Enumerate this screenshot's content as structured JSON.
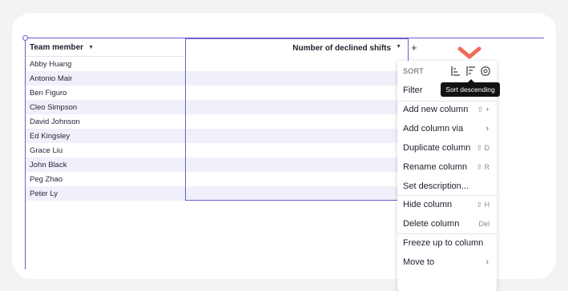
{
  "table": {
    "columns": [
      {
        "label": "Team member"
      },
      {
        "label": "Number of declined shifts"
      }
    ],
    "add_column_symbol": "+",
    "rows": [
      "Abby Huang",
      "Antonio Mair",
      "Ben Figuro",
      "Cleo Simpson",
      "David Johnson",
      "Ed Kingsley",
      "Grace Liu",
      "John Black",
      "Peg Zhao",
      "Peter Ly"
    ]
  },
  "menu": {
    "sort_label": "SORT",
    "items": [
      {
        "label": "Filter",
        "shortcut": "",
        "submenu": false
      },
      {
        "label": "Add new column",
        "shortcut": "⇧ +",
        "submenu": false
      },
      {
        "label": "Add column via",
        "shortcut": "",
        "submenu": true
      },
      {
        "label": "Duplicate column",
        "shortcut": "⇧ D",
        "submenu": false
      },
      {
        "label": "Rename column",
        "shortcut": "⇧ R",
        "submenu": false
      },
      {
        "label": "Set description...",
        "shortcut": "",
        "submenu": false
      },
      {
        "label": "Hide column",
        "shortcut": "⇧ H",
        "submenu": false
      },
      {
        "label": "Delete column",
        "shortcut": "Del",
        "submenu": false
      },
      {
        "label": "Freeze up to column",
        "shortcut": "",
        "submenu": false
      },
      {
        "label": "Move to",
        "shortcut": "",
        "submenu": true
      }
    ]
  },
  "tooltip": {
    "text": "Sort descending"
  },
  "icons": {
    "sort_ascending": "sort-ascending-icon",
    "sort_descending": "sort-descending-icon",
    "settings": "gear-icon",
    "pointer": "chevron-down-icon"
  },
  "colors": {
    "selection": "#6a5fd0",
    "row_alt": "#f0f0fa",
    "pointer": "#ee6a5b",
    "tooltip_bg": "#121212"
  }
}
